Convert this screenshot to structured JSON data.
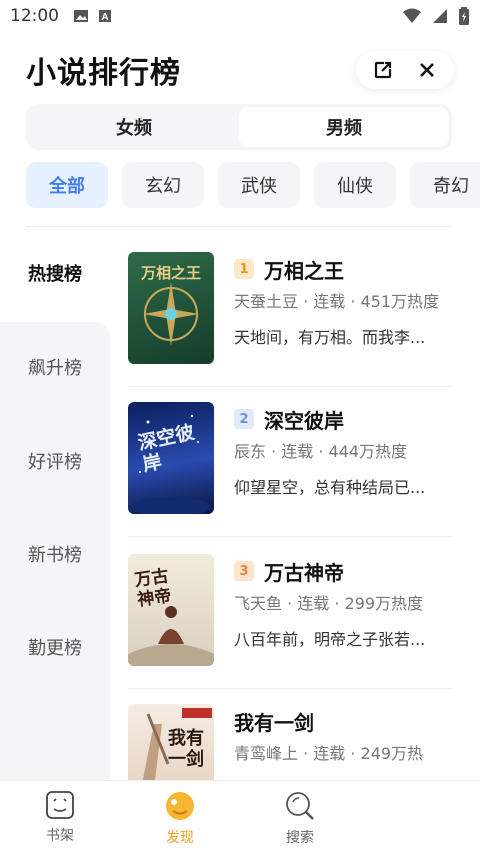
{
  "status": {
    "time": "12:00"
  },
  "header": {
    "title": "小说排行榜"
  },
  "gender_tabs": [
    {
      "label": "女频",
      "active": false
    },
    {
      "label": "男频",
      "active": true
    }
  ],
  "categories": [
    {
      "label": "全部",
      "active": true
    },
    {
      "label": "玄幻",
      "active": false
    },
    {
      "label": "武侠",
      "active": false
    },
    {
      "label": "仙侠",
      "active": false
    },
    {
      "label": "奇幻",
      "active": false
    }
  ],
  "side_menu": [
    {
      "label": "热搜榜",
      "active": true
    },
    {
      "label": "飙升榜",
      "active": false
    },
    {
      "label": "好评榜",
      "active": false
    },
    {
      "label": "新书榜",
      "active": false
    },
    {
      "label": "勤更榜",
      "active": false
    }
  ],
  "books": [
    {
      "rank": "1",
      "title": "万相之王",
      "meta": "天蚕土豆 · 连载 · 451万热度",
      "desc": "天地间，有万相。而我李...",
      "cover_text": "万相之王",
      "rank_color": "#f5a623"
    },
    {
      "rank": "2",
      "title": "深空彼岸",
      "meta": "辰东 · 连载 · 444万热度",
      "desc": "仰望星空，总有种结局已...",
      "cover_text": "深空彼岸",
      "rank_color": "#8aa8e8"
    },
    {
      "rank": "3",
      "title": "万古神帝",
      "meta": "飞天鱼 · 连载 · 299万热度",
      "desc": "八百年前，明帝之子张若...",
      "cover_text": "万古神帝",
      "rank_color": "#f0a060"
    },
    {
      "rank": "",
      "title": "我有一剑",
      "meta": "青鸾峰上 · 连载 · 249万热",
      "desc": "",
      "cover_text": "我有一剑",
      "rank_color": ""
    }
  ],
  "bottom_nav": [
    {
      "label": "书架",
      "icon": "bookshelf-icon",
      "active": false
    },
    {
      "label": "发现",
      "icon": "discover-icon",
      "active": true
    },
    {
      "label": "搜索",
      "icon": "search-icon",
      "active": false
    }
  ],
  "colors": {
    "accent": "#3d7ef0",
    "nav_active": "#f0a020",
    "panel_bg": "#f4f5f7"
  }
}
